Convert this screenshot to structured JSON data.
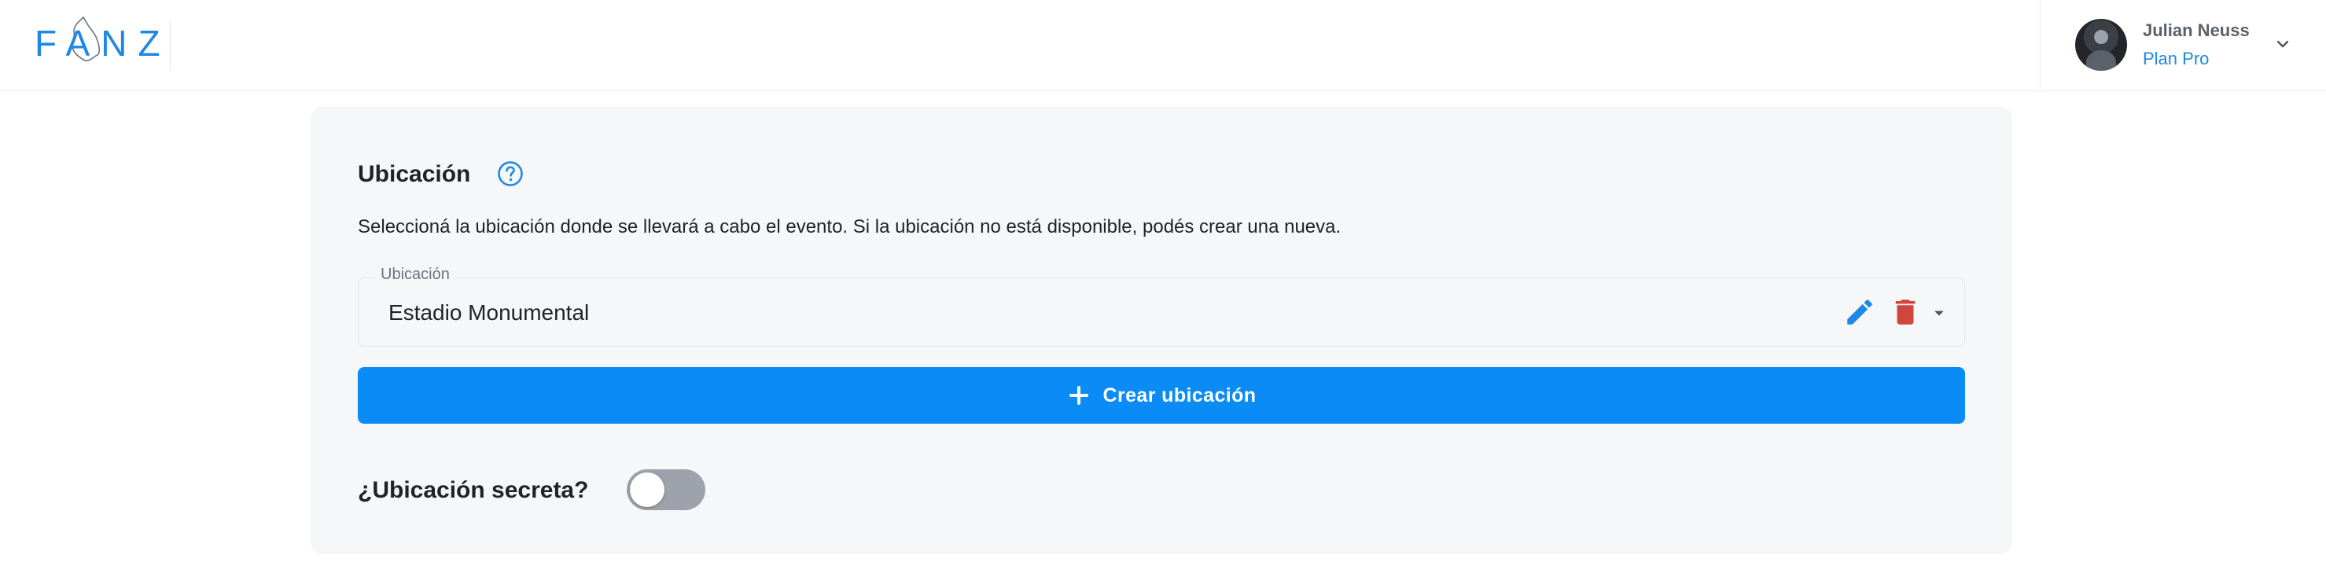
{
  "header": {
    "logo_text": "FANZ",
    "user": {
      "name": "Julian Neuss",
      "plan": "Plan Pro"
    }
  },
  "location_section": {
    "title": "Ubicación",
    "description": "Seleccioná la ubicación donde se llevará a cabo el evento. Si la ubicación no está disponible, podés crear una nueva.",
    "field_label": "Ubicación",
    "field_value": "Estadio Monumental",
    "create_button_label": "Crear ubicación",
    "secret_label": "¿Ubicación secreta?",
    "secret_enabled": false
  },
  "colors": {
    "brand": "#1e88e5",
    "primary_button": "#0a8bf5",
    "delete_icon": "#d0463b",
    "toggle_off": "#9ea3ab",
    "card_bg": "#f6f7f9"
  },
  "icons": {
    "help": "help-circle-icon",
    "edit": "pencil-icon",
    "delete": "trash-icon",
    "dropdown": "caret-down-icon",
    "add": "plus-icon",
    "user_menu": "chevron-down-icon"
  }
}
